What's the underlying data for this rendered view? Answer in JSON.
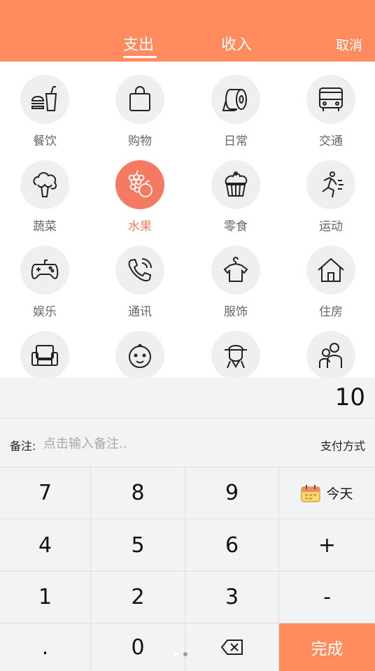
{
  "colors": {
    "accent": "#FF8B5E",
    "selected": "#F47B62"
  },
  "header": {
    "tabs": [
      {
        "label": "支出",
        "active": true
      },
      {
        "label": "收入",
        "active": false
      }
    ],
    "cancel_label": "取消"
  },
  "categories": [
    {
      "label": "餐饮",
      "icon": "burger-drink-icon"
    },
    {
      "label": "购物",
      "icon": "shopping-bag-icon"
    },
    {
      "label": "日常",
      "icon": "toilet-paper-icon"
    },
    {
      "label": "交通",
      "icon": "bus-icon"
    },
    {
      "label": "蔬菜",
      "icon": "broccoli-icon"
    },
    {
      "label": "水果",
      "icon": "grapes-orange-icon",
      "selected": true
    },
    {
      "label": "零食",
      "icon": "cupcake-icon"
    },
    {
      "label": "运动",
      "icon": "running-icon"
    },
    {
      "label": "娱乐",
      "icon": "gamepad-icon"
    },
    {
      "label": "通讯",
      "icon": "phone-icon"
    },
    {
      "label": "服饰",
      "icon": "shirt-hanger-icon"
    },
    {
      "label": "住房",
      "icon": "house-icon"
    },
    {
      "label": "",
      "icon": "sofa-icon"
    },
    {
      "label": "",
      "icon": "baby-icon"
    },
    {
      "label": "",
      "icon": "elder-icon"
    },
    {
      "label": "",
      "icon": "family-icon"
    }
  ],
  "amount": "10",
  "note": {
    "label": "备注:",
    "placeholder": "点击输入备注..",
    "pay_method": "支付方式"
  },
  "keypad": {
    "keys": [
      "7",
      "8",
      "9",
      "4",
      "5",
      "6",
      "+",
      "1",
      "2",
      "3",
      "-",
      ".",
      "0"
    ],
    "today_label": "今天",
    "done_label": "完成"
  },
  "page_dots": {
    "count": 2,
    "active_index": 1
  }
}
